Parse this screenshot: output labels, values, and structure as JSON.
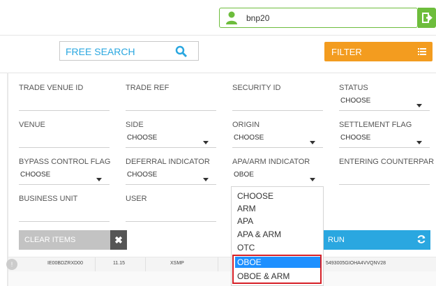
{
  "header": {
    "username": "bnp20",
    "colors": {
      "user_accent": "#6dbd3c"
    },
    "icons": {
      "user": "user-icon",
      "logout": "logout-icon"
    }
  },
  "toolbar": {
    "search_label": "FREE SEARCH",
    "filter_label": "FILTER",
    "colors": {
      "search_text": "#2aa7e0",
      "filter_bg": "#f39c1f"
    }
  },
  "fields": {
    "trade_venue_id": {
      "label": "TRADE VENUE ID"
    },
    "trade_ref": {
      "label": "TRADE REF"
    },
    "security_id": {
      "label": "SECURITY ID"
    },
    "status": {
      "label": "STATUS",
      "value": "CHOOSE"
    },
    "venue": {
      "label": "VENUE"
    },
    "side": {
      "label": "SIDE",
      "value": "CHOOSE"
    },
    "origin": {
      "label": "ORIGIN",
      "value": "CHOOSE"
    },
    "settlement_flag": {
      "label": "SETTLEMENT FLAG",
      "value": "CHOOSE"
    },
    "bypass_control_flag": {
      "label": "BYPASS CONTROL FLAG",
      "value": "CHOOSE"
    },
    "deferral_indicator": {
      "label": "DEFERRAL INDICATOR",
      "value": "CHOOSE"
    },
    "apa_arm_indicator": {
      "label": "APA/ARM INDICATOR",
      "value": "OBOE"
    },
    "entering_counterparty": {
      "label": "ENTERING COUNTERPAR"
    },
    "business_unit": {
      "label": "BUSINESS UNIT"
    },
    "user": {
      "label": "USER"
    }
  },
  "dropdown": {
    "options": [
      "CHOOSE",
      "ARM",
      "APA",
      "APA & ARM",
      "OTC",
      "OBOE",
      "OBOE & ARM"
    ],
    "selected": "OBOE",
    "colors": {
      "selected_bg": "#1e90ff",
      "highlight_border": "#d61f26"
    }
  },
  "actions": {
    "clear_label": "CLEAR ITEMS",
    "run_label": "RUN",
    "colors": {
      "clear_bg": "#c3c3c3",
      "run_bg": "#2aa7e0"
    }
  },
  "table": {
    "rows": [
      {
        "id": "IE00BDZRXD00",
        "price": "11.15",
        "venue": "XSMP",
        "lei": "5493005GIOHA4VVQNV28"
      }
    ]
  }
}
